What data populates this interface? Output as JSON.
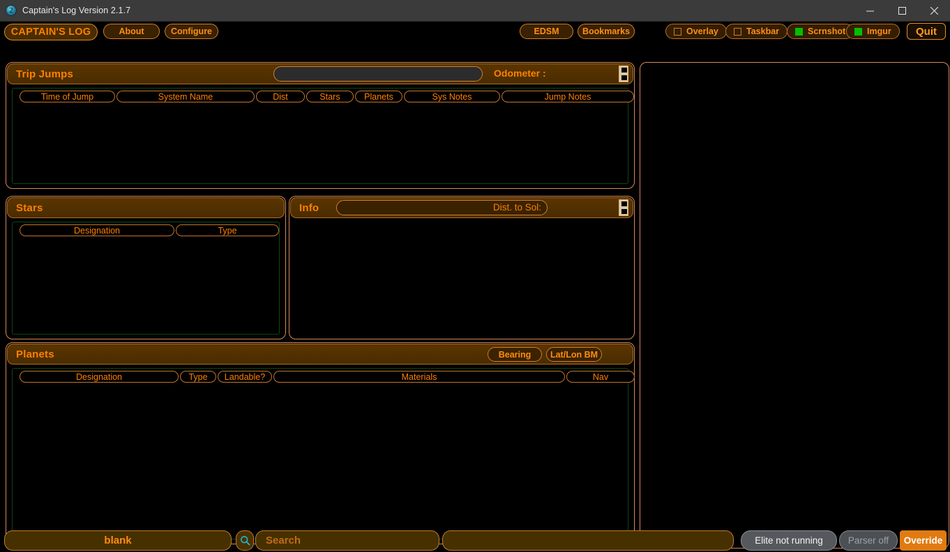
{
  "window": {
    "title": "Captain's Log Version 2.1.7",
    "icon": "app-icon",
    "controls": {
      "minimize": "minimize-icon",
      "maximize": "maximize-icon",
      "close": "close-icon"
    }
  },
  "toolbar": {
    "app_button": "CAPTAIN'S LOG",
    "about": "About",
    "configure": "Configure",
    "edsm": "EDSM",
    "bookmarks": "Bookmarks",
    "quit": "Quit",
    "checkboxes": [
      {
        "label": "Overlay",
        "checked": false
      },
      {
        "label": "Taskbar",
        "checked": false
      },
      {
        "label": "Scrnshot",
        "checked": true
      },
      {
        "label": "Imgur",
        "checked": true
      }
    ]
  },
  "trip_jumps": {
    "title": "Trip Jumps",
    "odometer_label": "Odometer :",
    "odometer_value": "",
    "columns": [
      "Time of Jump",
      "System Name",
      "Dist",
      "Stars",
      "Planets",
      "Sys Notes",
      "Jump Notes"
    ],
    "rows": []
  },
  "stars": {
    "title": "Stars",
    "columns": [
      "Designation",
      "Type"
    ],
    "rows": []
  },
  "info": {
    "title": "Info",
    "dist_to_sol_label": "Dist. to Sol:",
    "dist_to_sol_value": "",
    "body": ""
  },
  "planets": {
    "title": "Planets",
    "bearing_button": "Bearing",
    "latlon_button": "Lat/Lon BM",
    "columns": [
      "Designation",
      "Type",
      "Landable?",
      "Materials",
      "Nav"
    ],
    "rows": []
  },
  "right_panel": {
    "content": ""
  },
  "bottom_bar": {
    "blank_label": "blank",
    "search_icon": "search-icon",
    "search_placeholder": "Search",
    "search_value": "",
    "message_value": "",
    "status_elite": "Elite not running",
    "status_parser": "Parser off",
    "status_override": "Override"
  },
  "colors": {
    "accent_orange": "#ff8000",
    "panel_header_brown": "#4a2c00",
    "border_tan": "#d4895a",
    "list_border_green": "#114411",
    "checkbox_on_green": "#00c000",
    "override_orange": "#e07b12",
    "titlebar_gray": "#3b3b3b"
  }
}
